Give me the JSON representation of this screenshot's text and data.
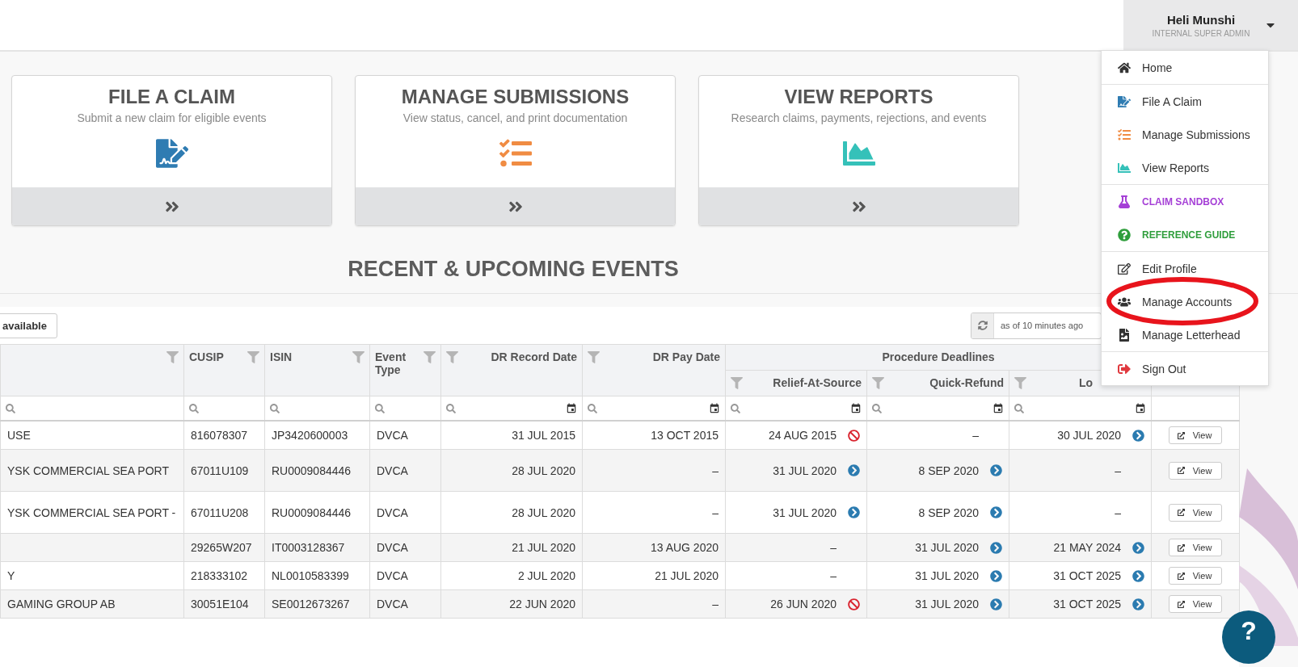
{
  "user": {
    "name": "Heli Munshi",
    "role": "INTERNAL SUPER ADMIN"
  },
  "menu": {
    "groups": [
      [
        {
          "kind": "link",
          "label": "Home",
          "circled": false
        }
      ],
      [
        {
          "kind": "link",
          "label": "File A Claim",
          "circled": false
        },
        {
          "kind": "link",
          "label": "Manage Submissions",
          "circled": false
        },
        {
          "kind": "link",
          "label": "View Reports",
          "circled": false
        }
      ],
      [
        {
          "kind": "accent",
          "label": "CLAIM SANDBOX",
          "color": "#a53fd6",
          "circled": false
        },
        {
          "kind": "accent",
          "label": "REFERENCE GUIDE",
          "color": "#2f9e3c",
          "circled": false
        }
      ],
      [
        {
          "kind": "link",
          "label": "Edit Profile",
          "circled": false
        },
        {
          "kind": "link",
          "label": "Manage Accounts",
          "circled": true
        },
        {
          "kind": "link",
          "label": "Manage Letterhead",
          "circled": false
        }
      ],
      [
        {
          "kind": "link",
          "label": "Sign Out",
          "circled": false
        }
      ]
    ]
  },
  "cards": [
    {
      "title": "FILE A CLAIM",
      "subtitle": "Submit a new claim for eligible events"
    },
    {
      "title": "MANAGE SUBMISSIONS",
      "subtitle": "View status, cancel, and print documentation"
    },
    {
      "title": "VIEW REPORTS",
      "subtitle": "Research claims, payments, rejections, and events"
    }
  ],
  "events": {
    "title": "RECENT & UPCOMING EVENTS",
    "filter_button": "available",
    "updated": "as of 10 minutes ago",
    "group_header": "Procedure Deadlines",
    "columns": [
      {
        "kind": "text"
      },
      {
        "kind": "text",
        "label": "CUSIP"
      },
      {
        "kind": "text",
        "label": "ISIN"
      },
      {
        "kind": "text",
        "label": "Event Type"
      },
      {
        "kind": "date",
        "label": "DR Record Date"
      },
      {
        "kind": "date",
        "label": "DR Pay Date"
      }
    ],
    "deadline_columns": [
      {
        "kind": "date",
        "label": "Relief-At-Source"
      },
      {
        "kind": "date",
        "label": "Quick-Refund"
      },
      {
        "kind": "date",
        "label": "Lo"
      }
    ],
    "rows": [
      {
        "name": "USE",
        "cusip": "816078307",
        "isin": "JP3420600003",
        "type": "DVCA",
        "record": "31 JUL 2015",
        "pay": "13 OCT 2015",
        "deadlines": [
          {
            "text": "24 AUG 2015",
            "kind": "blocked"
          },
          {
            "text": "–",
            "kind": "none"
          },
          {
            "text": "30 JUL 2020",
            "kind": "go"
          }
        ],
        "action": "View"
      },
      {
        "name": "YSK COMMERCIAL SEA PORT",
        "cusip": "67011U109",
        "isin": "RU0009084446",
        "type": "DVCA",
        "record": "28 JUL 2020",
        "pay": "–",
        "deadlines": [
          {
            "text": "31 JUL 2020",
            "kind": "go"
          },
          {
            "text": "8 SEP 2020",
            "kind": "go"
          },
          {
            "text": "–",
            "kind": "none"
          }
        ],
        "action": "View"
      },
      {
        "name": "YSK COMMERCIAL SEA PORT -",
        "cusip": "67011U208",
        "isin": "RU0009084446",
        "type": "DVCA",
        "record": "28 JUL 2020",
        "pay": "–",
        "deadlines": [
          {
            "text": "31 JUL 2020",
            "kind": "go"
          },
          {
            "text": "8 SEP 2020",
            "kind": "go"
          },
          {
            "text": "–",
            "kind": "none"
          }
        ],
        "action": "View"
      },
      {
        "cusip": "29265W207",
        "isin": "IT0003128367",
        "type": "DVCA",
        "record": "21 JUL 2020",
        "pay": "13 AUG 2020",
        "deadlines": [
          {
            "text": "–",
            "kind": "none"
          },
          {
            "text": "31 JUL 2020",
            "kind": "go"
          },
          {
            "text": "21 MAY 2024",
            "kind": "go"
          }
        ],
        "action": "View"
      },
      {
        "name": "Y",
        "cusip": "218333102",
        "isin": "NL0010583399",
        "type": "DVCA",
        "record": "2 JUL 2020",
        "pay": "21 JUL 2020",
        "deadlines": [
          {
            "text": "–",
            "kind": "none"
          },
          {
            "text": "31 JUL 2020",
            "kind": "go"
          },
          {
            "text": "31 OCT 2025",
            "kind": "go"
          }
        ],
        "action": "View"
      },
      {
        "name": "GAMING GROUP AB",
        "cusip": "30051E104",
        "isin": "SE0012673267",
        "type": "DVCA",
        "record": "22 JUN 2020",
        "pay": "–",
        "deadlines": [
          {
            "text": "26 JUN 2020",
            "kind": "blocked"
          },
          {
            "text": "31 JUL 2020",
            "kind": "go"
          },
          {
            "text": "31 OCT 2025",
            "kind": "go"
          }
        ],
        "action": "View"
      }
    ]
  },
  "help": {
    "label": "?"
  }
}
